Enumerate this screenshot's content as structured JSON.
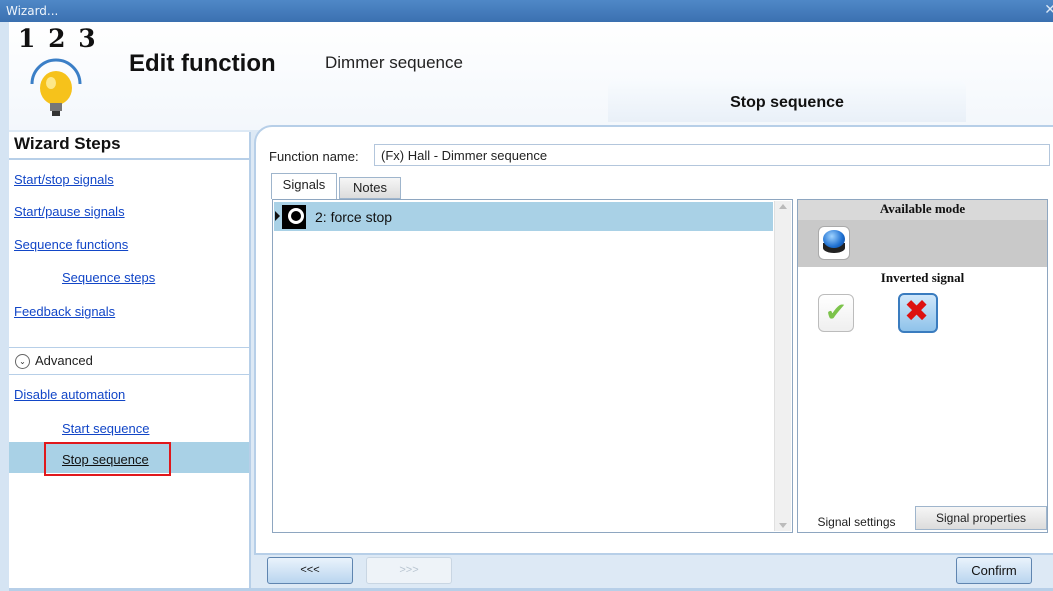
{
  "window": {
    "title": "Wizard...",
    "close_glyph": "✕"
  },
  "header": {
    "logo_numbers": "1 2 3",
    "title": "Edit function",
    "subtitle": "Dimmer sequence",
    "current_step_tab": "Stop sequence"
  },
  "sidebar": {
    "title": "Wizard Steps",
    "items": [
      {
        "label": "Start/stop signals"
      },
      {
        "label": "Start/pause signals"
      },
      {
        "label": "Sequence functions"
      },
      {
        "label": "Sequence steps"
      },
      {
        "label": "Feedback signals"
      }
    ],
    "advanced": {
      "label": "Advanced",
      "icon": "chevron-down-icon"
    },
    "advanced_items": [
      {
        "label": "Disable automation"
      },
      {
        "label": "Start sequence"
      },
      {
        "label": "Stop sequence",
        "selected": true
      }
    ],
    "selection_color": "#a9d1e6",
    "highlight_box_color": "#e0181c"
  },
  "main": {
    "function_name_label": "Function name:",
    "function_name_value": "(Fx) Hall - Dimmer sequence",
    "tabs": [
      {
        "label": "Signals",
        "active": true
      },
      {
        "label": "Notes",
        "active": false
      }
    ],
    "signals": [
      {
        "label": "2: force stop",
        "icon": "signal-force-stop-icon"
      }
    ]
  },
  "signal_panel": {
    "available_mode_header": "Available mode",
    "available_mode_icon": "blue-pushbutton-icon",
    "inverted_signal_header": "Inverted signal",
    "inverted_options": [
      {
        "icon": "check-icon",
        "glyph": "✔",
        "selected": false
      },
      {
        "icon": "x-icon",
        "glyph": "✖",
        "selected": true
      }
    ],
    "tabs": [
      {
        "label": "Signal settings",
        "active": true
      },
      {
        "label": "Signal properties",
        "active": false
      }
    ]
  },
  "footer": {
    "back_label": "<<<",
    "next_label": ">>>",
    "confirm_label": "Confirm"
  }
}
